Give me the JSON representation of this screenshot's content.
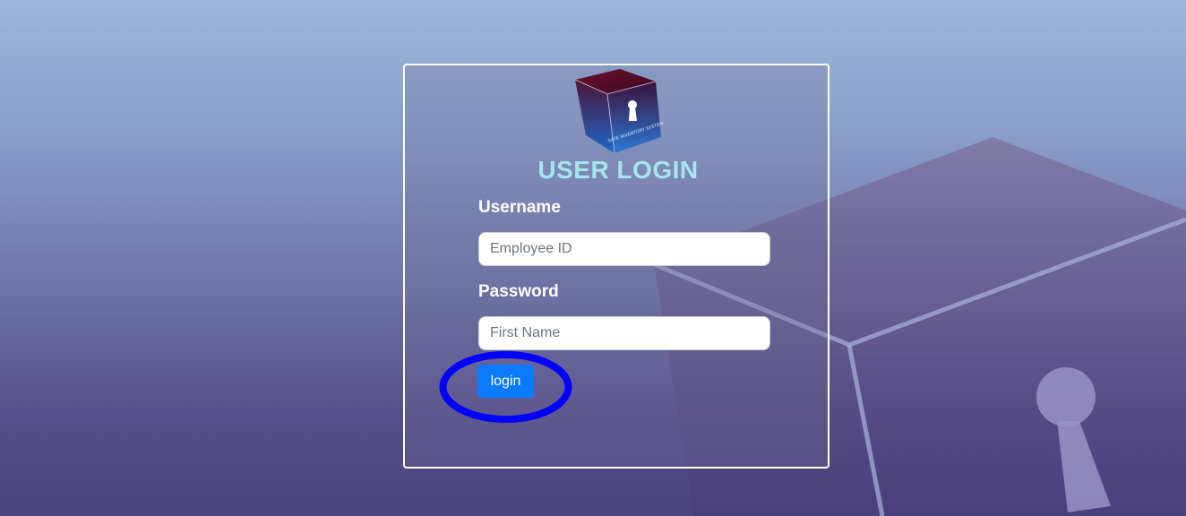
{
  "page": {
    "title": "USER LOGIN",
    "logo_text": "SAFE INVENTORY SYSTEM"
  },
  "form": {
    "username_label": "Username",
    "username_placeholder": "Employee ID",
    "password_label": "Password",
    "password_placeholder": "First Name",
    "login_label": "login"
  },
  "colors": {
    "title": "#a8e6ef",
    "button": "#0a7bff",
    "highlight_ring": "#0000ff"
  },
  "icons": {
    "logo": "keyhole-cube-icon",
    "background": "keyhole-cube-icon"
  }
}
